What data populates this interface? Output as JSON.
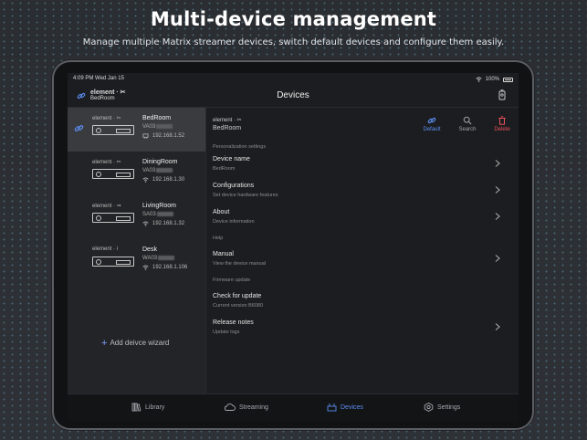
{
  "banner": {
    "title": "Multi-device management",
    "subtitle": "Manage multiple Matrix streamer devices, switch default devices and configure them easily."
  },
  "status_bar": {
    "time_date": "4:09 PM   Wed Jan 15",
    "battery": "100%"
  },
  "nav": {
    "brand": "element · ✂",
    "room": "BedRoom",
    "title": "Devices"
  },
  "devices": [
    {
      "brand": "element · ✂",
      "name": "BedRoom",
      "serial": "VA03",
      "ip": "192.168.1.52",
      "connection": "ethernet",
      "selected": true
    },
    {
      "brand": "element · ✂",
      "name": "DiningRoom",
      "serial": "VA03",
      "ip": "192.168.1.30",
      "connection": "wifi",
      "selected": false
    },
    {
      "brand": "element · ⇒",
      "name": "LivingRoom",
      "serial": "SA03",
      "ip": "192.168.1.32",
      "connection": "wifi",
      "selected": false
    },
    {
      "brand": "element · i",
      "name": "Desk",
      "serial": "WA03",
      "ip": "192.168.1.106",
      "connection": "wifi",
      "selected": false
    }
  ],
  "add_wizard": {
    "plus": "+",
    "label": "Add deivce wizard"
  },
  "detail": {
    "brand": "element · ✂",
    "room": "BedRoom",
    "actions": {
      "default": "Default",
      "search": "Search",
      "delete": "Delete"
    },
    "sections": {
      "personalization": "Personalization settings",
      "help": "Help",
      "firmware": "Firmware update"
    },
    "rows": {
      "device_name": {
        "title": "Device name",
        "sub": "BedRoom"
      },
      "configurations": {
        "title": "Configurations",
        "sub": "Set device hardware features"
      },
      "about": {
        "title": "About",
        "sub": "Device information"
      },
      "manual": {
        "title": "Manual",
        "sub": "View the device manual"
      },
      "check_update": {
        "title": "Check for update",
        "sub": "Current version B6080"
      },
      "release_notes": {
        "title": "Release notes",
        "sub": "Update logs"
      }
    }
  },
  "tabs": {
    "library": "Library",
    "streaming": "Streaming",
    "devices": "Devices",
    "settings": "Settings"
  },
  "colors": {
    "accent": "#5b8ef0",
    "danger": "#e8505a",
    "selected_row": "#3a3b3f"
  }
}
